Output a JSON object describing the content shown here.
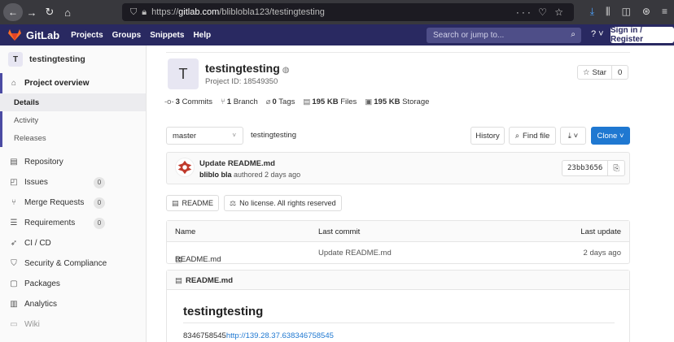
{
  "browser": {
    "url_prefix": "https://",
    "url_host": "gitlab.com",
    "url_path": "/bliblobla123/testingtesting",
    "url_actions": "··· ♡ ☆"
  },
  "navbar": {
    "brand": "GitLab",
    "menu": [
      "Projects",
      "Groups",
      "Snippets",
      "Help"
    ],
    "search_placeholder": "Search or jump to...",
    "help_icon": "? ˅",
    "signin": "Sign in / Register",
    "accent": "#292961"
  },
  "sidebar": {
    "project_initial": "T",
    "project_name": "testingtesting",
    "overview": "Project overview",
    "overview_items": [
      "Details",
      "Activity",
      "Releases"
    ],
    "items": [
      {
        "label": "Repository",
        "icon": "book-icon"
      },
      {
        "label": "Issues",
        "icon": "issues-icon",
        "badge": "0"
      },
      {
        "label": "Merge Requests",
        "icon": "merge-request-icon",
        "badge": "0"
      },
      {
        "label": "Requirements",
        "icon": "requirements-icon",
        "badge": "0"
      },
      {
        "label": "CI / CD",
        "icon": "rocket-icon"
      },
      {
        "label": "Security & Compliance",
        "icon": "shield-icon"
      },
      {
        "label": "Packages",
        "icon": "package-icon"
      },
      {
        "label": "Analytics",
        "icon": "chart-icon"
      },
      {
        "label": "Wiki",
        "icon": "wiki-icon"
      }
    ]
  },
  "project": {
    "initial": "T",
    "title": "testingtesting",
    "id_text": "Project ID: 18549350",
    "star_label": "Star",
    "star_count": "0",
    "stats": {
      "commits_n": "3",
      "commits_label": "Commits",
      "branch_n": "1",
      "branch_label": "Branch",
      "tags_n": "0",
      "tags_label": "Tags",
      "files_n": "195 KB",
      "files_label": "Files",
      "storage_n": "195 KB",
      "storage_label": "Storage"
    }
  },
  "repo": {
    "branch": "master",
    "crumb": "testingtesting",
    "history": "History",
    "find_file": "Find file",
    "download": "⤓ ˅",
    "clone": "Clone ˅"
  },
  "commit": {
    "title": "Update README.md",
    "author": "bliblo bla",
    "meta": "authored 2 days ago",
    "sha": "23bb3656"
  },
  "readme_buttons": {
    "readme": "README",
    "license": "No license. All rights reserved"
  },
  "file_table": {
    "headers": [
      "Name",
      "Last commit",
      "Last update"
    ],
    "rows": [
      {
        "name": "README.md",
        "commit": "Update README.md",
        "updated": "2 days ago"
      }
    ]
  },
  "readme": {
    "filename": "README.md",
    "heading": "testingtesting",
    "text_prefix": "8346758545",
    "link": "http://139.28.37.638346758545"
  }
}
